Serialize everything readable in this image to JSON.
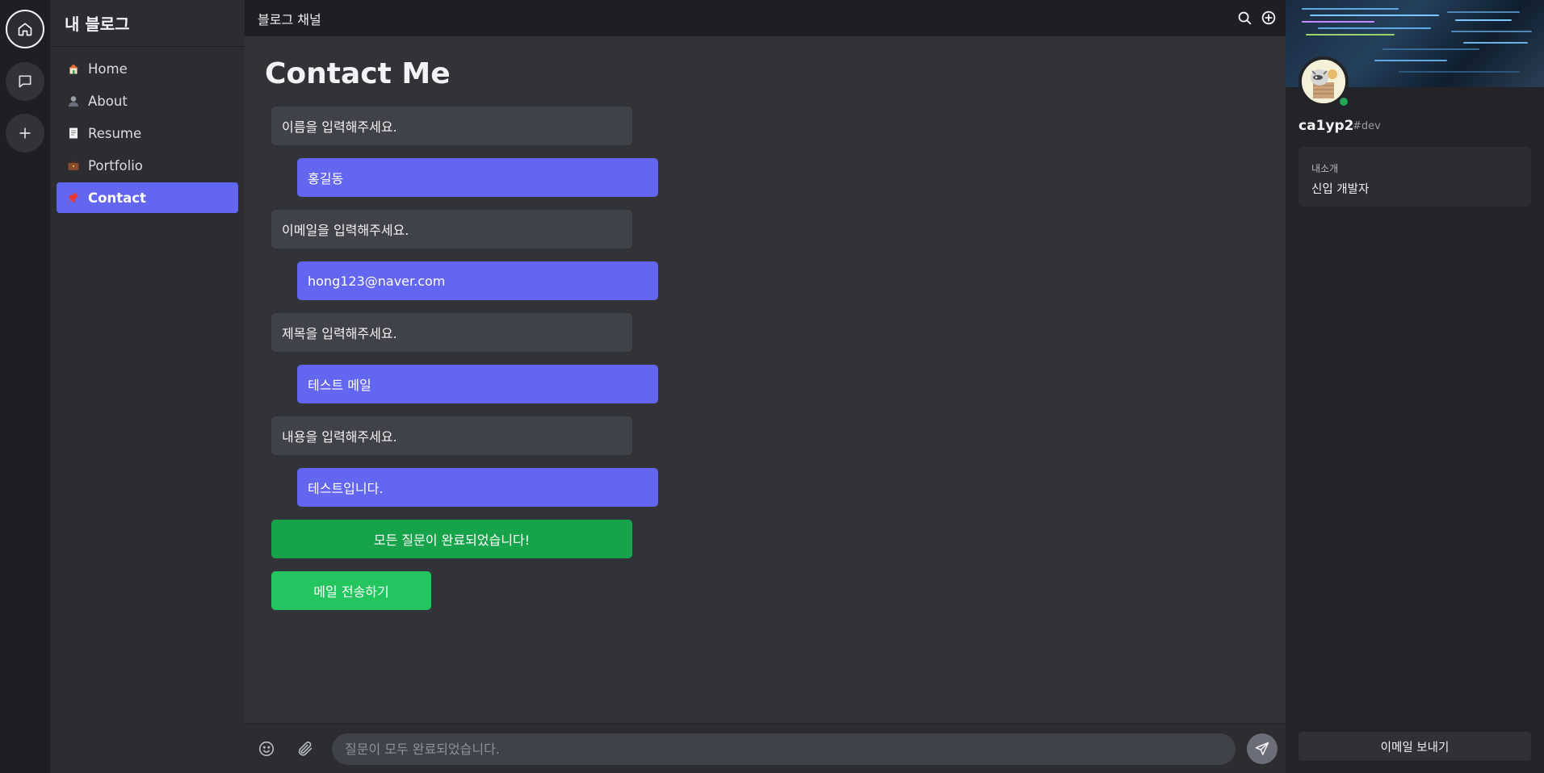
{
  "sidebar": {
    "title": "내 블로그",
    "items": [
      {
        "label": "Home",
        "icon": "house-icon"
      },
      {
        "label": "About",
        "icon": "person-icon"
      },
      {
        "label": "Resume",
        "icon": "document-icon"
      },
      {
        "label": "Portfolio",
        "icon": "briefcase-icon"
      },
      {
        "label": "Contact",
        "icon": "pushpin-icon",
        "active": true
      }
    ]
  },
  "topbar": {
    "channel": "블로그 채널"
  },
  "main": {
    "title": "Contact Me",
    "questions": [
      {
        "q": "이름을 입력해주세요.",
        "a": "홍길동"
      },
      {
        "q": "이메일을 입력해주세요.",
        "a": "hong123@naver.com"
      },
      {
        "q": "제목을 입력해주세요.",
        "a": "테스트 메일"
      },
      {
        "q": "내용을 입력해주세요.",
        "a": "테스트입니다."
      }
    ],
    "done_message": "모든 질문이 완료되었습니다!",
    "send_button": "메일 전송하기"
  },
  "composer": {
    "placeholder": "질문이 모두 완료되었습니다."
  },
  "profile": {
    "name": "ca1yp2",
    "tag": "#dev",
    "bio_label": "내소개",
    "bio_text": "신입 개발자",
    "email_button": "이메일 보내기"
  },
  "colors": {
    "accent": "#6366f1",
    "done": "#16a34a",
    "send": "#22c55e",
    "online": "#23a55a"
  }
}
